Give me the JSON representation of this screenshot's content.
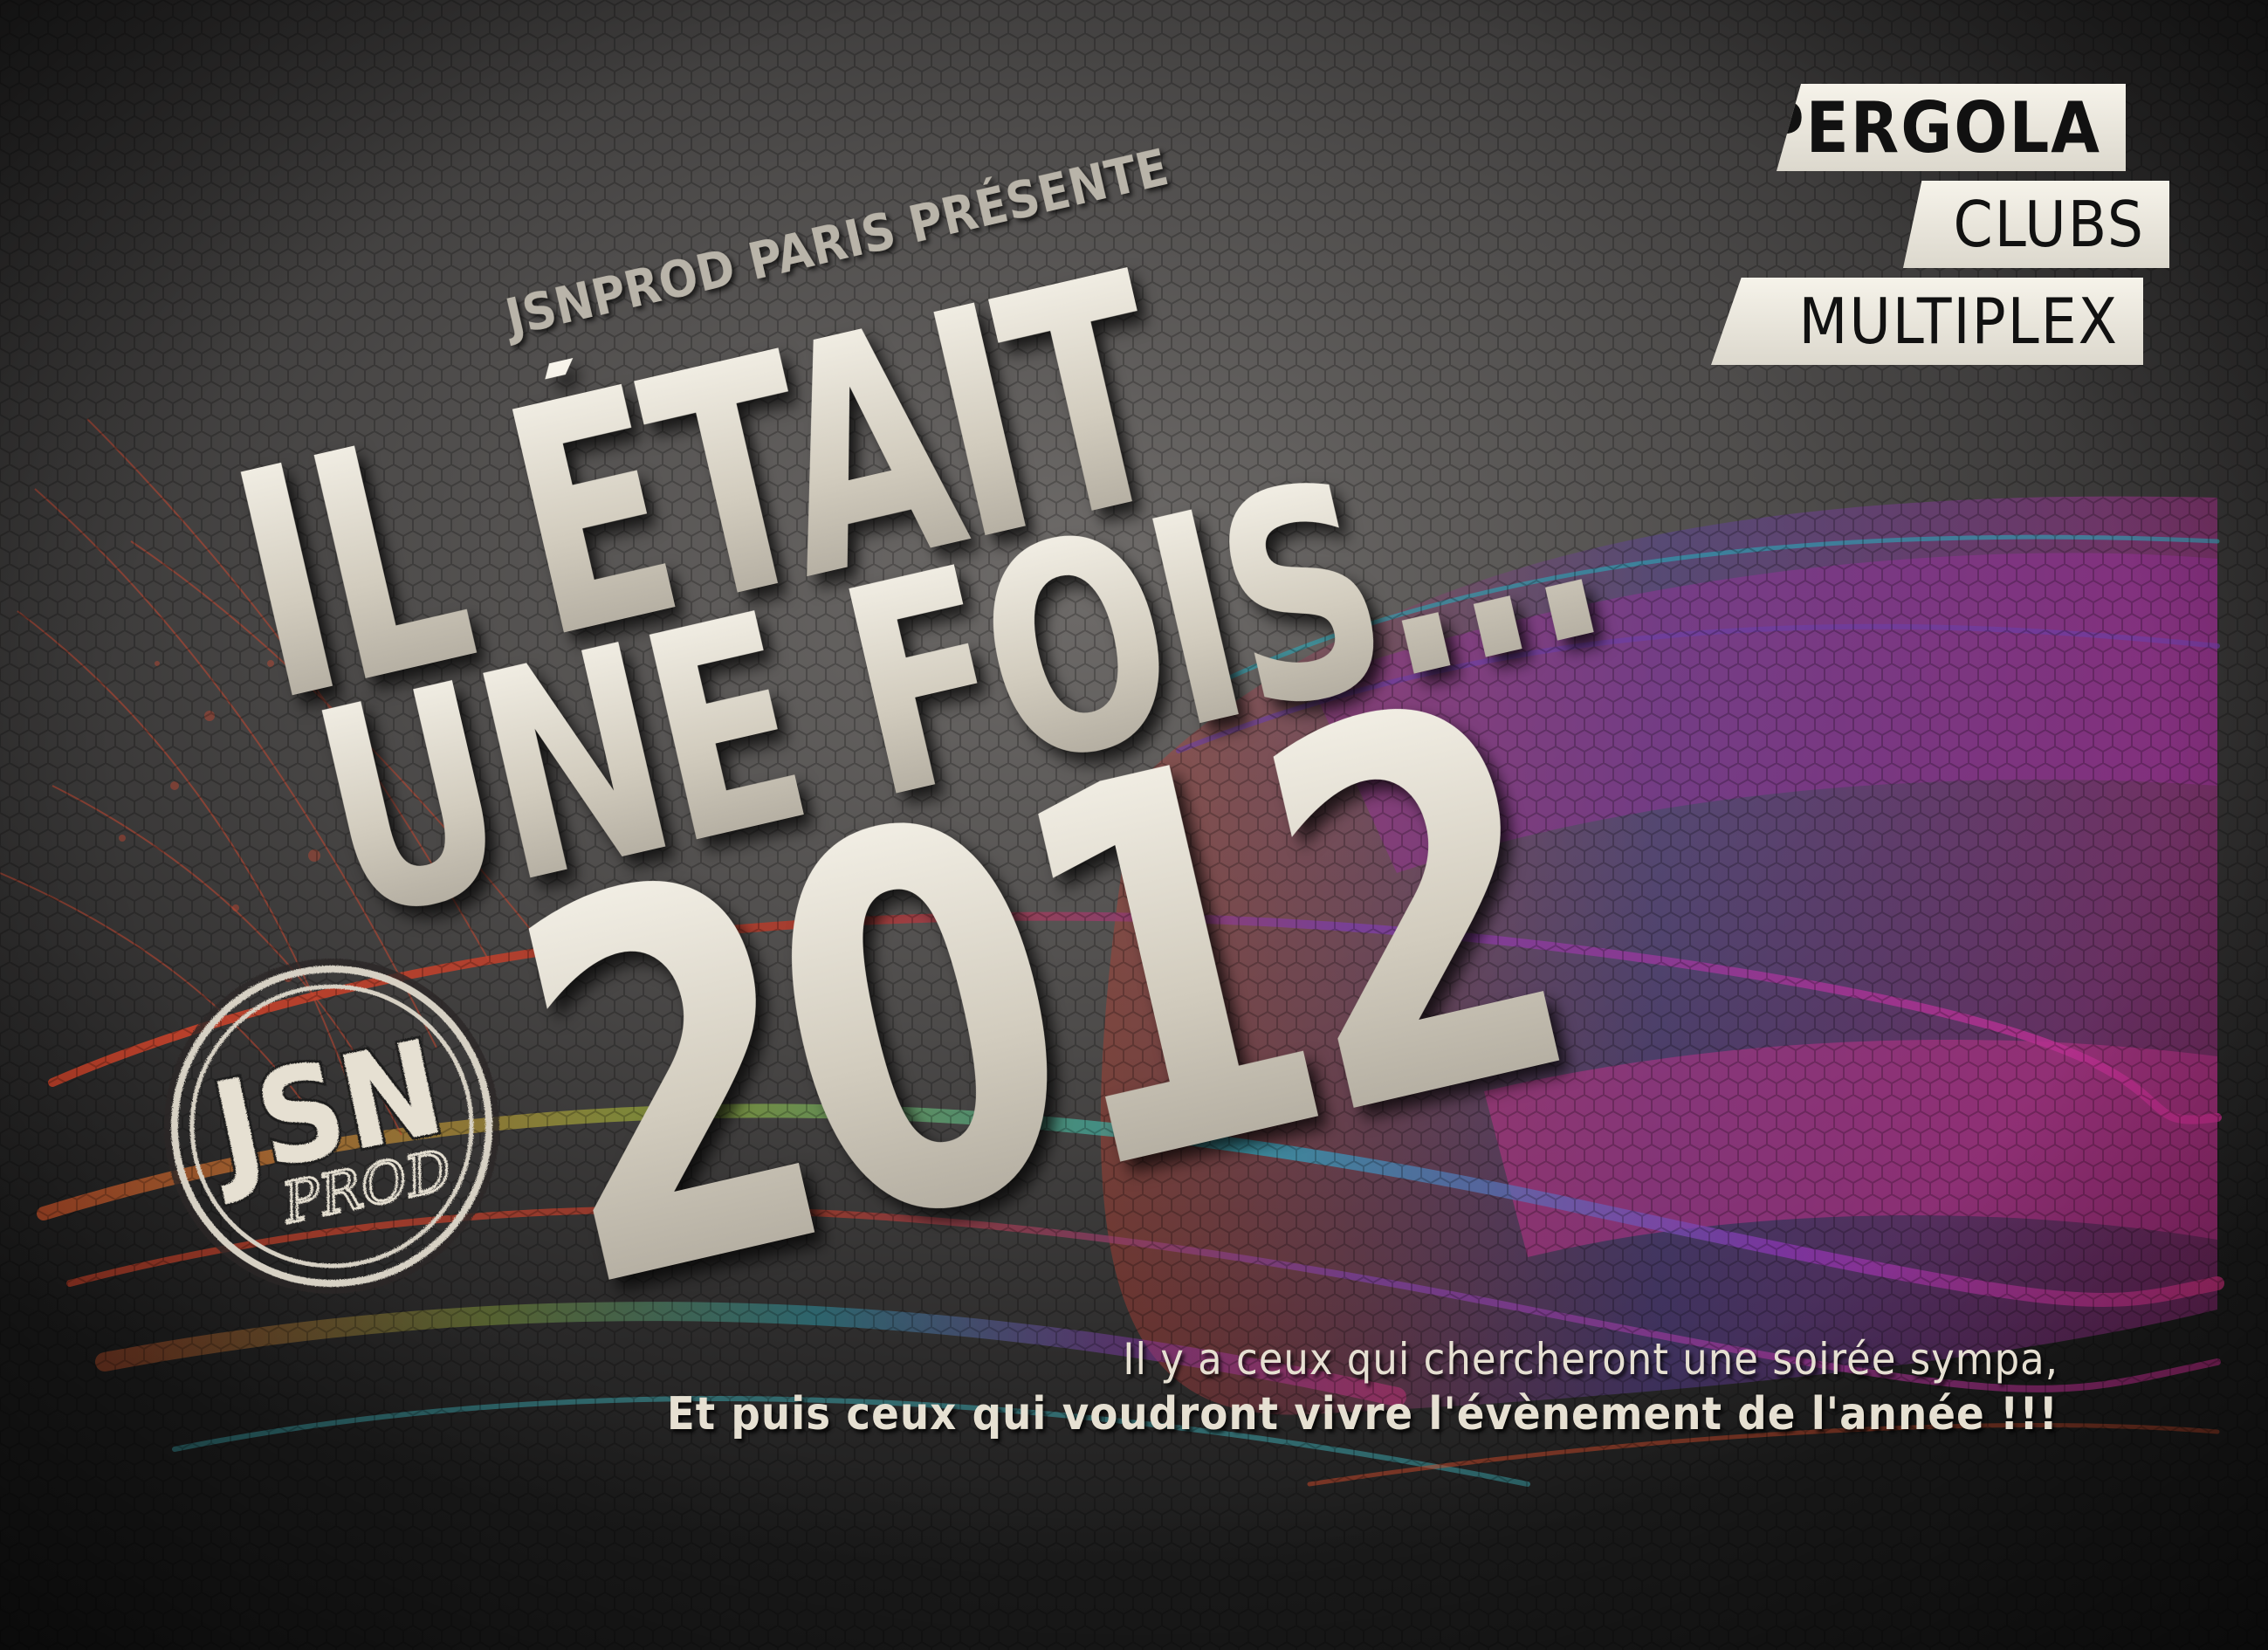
{
  "presenter": "JSNPROD PARIS PRÉSENTE",
  "title": {
    "line1": "IL ÉTAIT",
    "line2": "UNE FOIS...",
    "line3": "2012"
  },
  "venues": [
    "PERGOLA",
    "CLUBS",
    "MULTIPLEX"
  ],
  "logo": {
    "main": "JSN",
    "sub": "PROD"
  },
  "tagline": {
    "line1": "Il y a ceux qui chercheront une soirée sympa,",
    "line2": "Et puis ceux qui voudront vivre l'évènement de l'année !!!"
  },
  "colors": {
    "background": "#4e4c4b",
    "title": "#e6e1d6",
    "tag_background": "#ece8de",
    "tag_text": "#111111",
    "swirl_red": "#d84a2a",
    "swirl_magenta": "#c02c8c",
    "swirl_purple": "#7d2fa8",
    "swirl_teal": "#2aa6b8"
  }
}
